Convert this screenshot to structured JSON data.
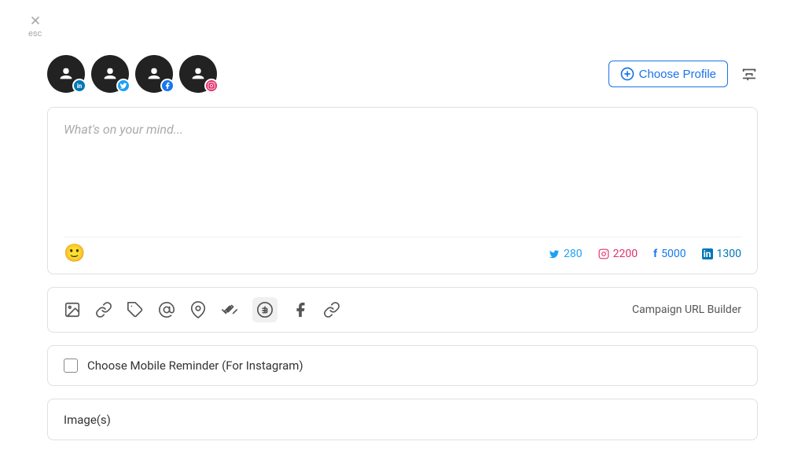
{
  "esc": {
    "label": "esc"
  },
  "profiles": [
    {
      "id": "linkedin",
      "badge": "in",
      "badge_class": "badge-linkedin"
    },
    {
      "id": "twitter",
      "badge": "t",
      "badge_class": "badge-twitter"
    },
    {
      "id": "facebook",
      "badge": "f",
      "badge_class": "badge-facebook"
    },
    {
      "id": "instagram",
      "badge": "ig",
      "badge_class": "badge-instagram"
    }
  ],
  "choose_profile": {
    "label": "Choose Profile"
  },
  "compose": {
    "placeholder": "What's on your mind...",
    "char_counts": {
      "twitter": "280",
      "instagram": "2200",
      "facebook": "5000",
      "linkedin": "1300"
    }
  },
  "toolbar": {
    "campaign_url_label": "Campaign URL Builder"
  },
  "reminder": {
    "label": "Choose Mobile Reminder (For Instagram)"
  },
  "images": {
    "header": "Image(s)"
  }
}
